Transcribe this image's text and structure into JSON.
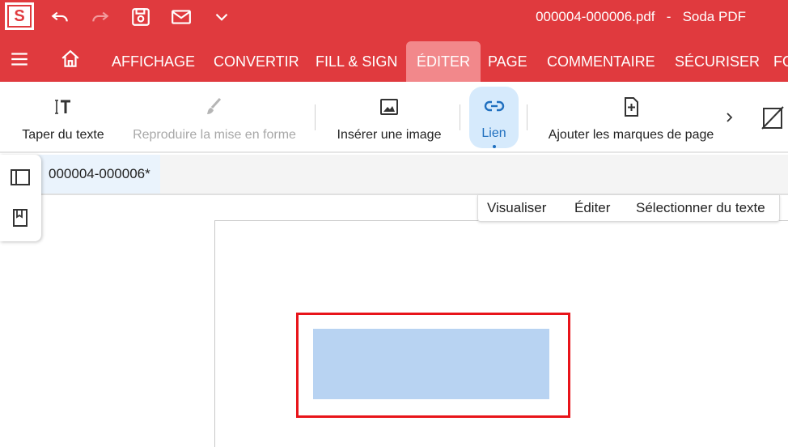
{
  "title_bar": {
    "logo_letter": "S",
    "file_name": "000004-000006.pdf",
    "separator": "-",
    "app_name": "Soda PDF"
  },
  "nav": {
    "tabs": [
      {
        "label": "AFFICHAGE"
      },
      {
        "label": "CONVERTIR"
      },
      {
        "label": "FILL & SIGN"
      },
      {
        "label": "ÉDITER",
        "active": true
      },
      {
        "label": "PAGE"
      },
      {
        "label": "COMMENTAIRE"
      },
      {
        "label": "SÉCURISER"
      },
      {
        "label": "FO"
      }
    ]
  },
  "toolbar": {
    "tools": [
      {
        "label": "Taper du texte",
        "icon": "text-cursor-icon"
      },
      {
        "label": "Reproduire la mise en forme",
        "icon": "paintbrush-icon",
        "disabled": true
      },
      {
        "label": "Insérer une image",
        "icon": "image-icon"
      },
      {
        "label": "Lien",
        "icon": "link-icon",
        "active": true
      },
      {
        "label": "Ajouter les marques de page",
        "icon": "file-plus-icon"
      }
    ],
    "more_icon": "chevron-right-icon"
  },
  "document_tab": {
    "label": "000004-000006*"
  },
  "view_modes": {
    "view": "Visualiser",
    "edit": "Éditer",
    "select_text": "Sélectionner du texte"
  },
  "colors": {
    "brand_red": "#e03a3e",
    "active_tab": "#f2888b",
    "active_tool": "#d6eafc",
    "link_border": "#e8141a",
    "link_fill": "#b8d3f2"
  }
}
